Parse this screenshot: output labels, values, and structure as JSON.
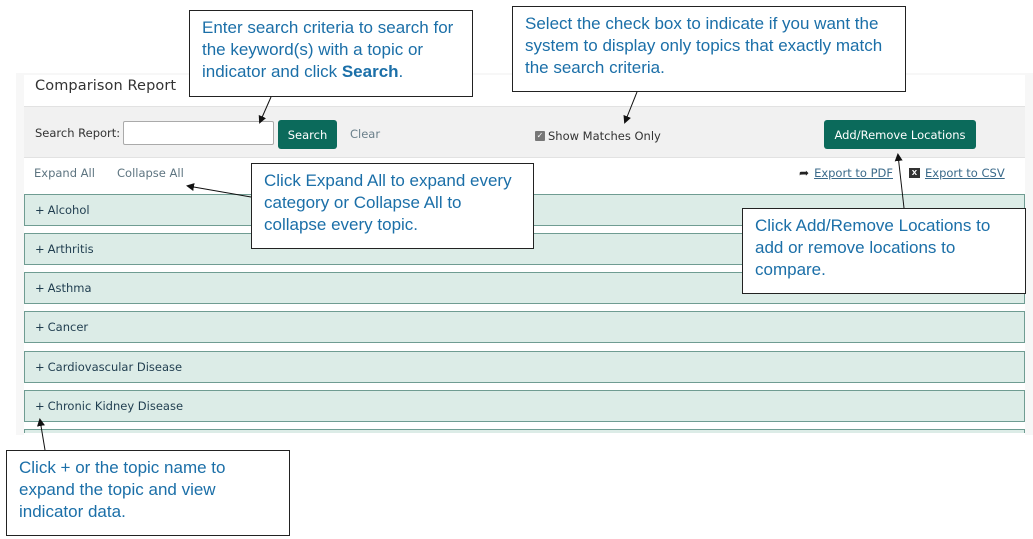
{
  "page": {
    "title": "Comparison Report"
  },
  "search": {
    "label": "Search Report:",
    "value": "",
    "placeholder": "",
    "search_button": "Search",
    "clear_link": "Clear",
    "show_matches_only": {
      "label": "Show Matches Only",
      "checked": true
    },
    "add_remove_button": "Add/Remove Locations"
  },
  "toolbar": {
    "expand_all": "Expand All",
    "collapse_all": "Collapse All",
    "export_pdf": "Export to PDF",
    "export_csv": "Export to CSV",
    "export_pdf_icon": "share-arrow-icon",
    "export_csv_icon": "excel-icon"
  },
  "topics": [
    {
      "expander": "+",
      "label": "Alcohol"
    },
    {
      "expander": "+",
      "label": "Arthritis"
    },
    {
      "expander": "+",
      "label": "Asthma"
    },
    {
      "expander": "+",
      "label": "Cancer"
    },
    {
      "expander": "+",
      "label": "Cardiovascular Disease"
    },
    {
      "expander": "+",
      "label": "Chronic Kidney Disease"
    }
  ],
  "callouts": {
    "search": {
      "text": "Enter search criteria to search for the keyword(s) with a topic or indicator and click ",
      "bold": "Search",
      "end": "."
    },
    "matches": {
      "text": "Select the check box to indicate if you want the system to display only topics that exactly match the search criteria."
    },
    "expand": {
      "text": "Click Expand All to expand every category or Collapse All to collapse every topic."
    },
    "locations": {
      "text": "Click Add/Remove Locations to add or remove locations to compare."
    },
    "topic": {
      "text": "Click + or the topic name to expand the topic and view indicator data."
    }
  },
  "colors": {
    "accent_green": "#0b6a5b",
    "topic_bg": "#dcece7",
    "topic_border": "#6f9c92",
    "callout_text": "#1b6fa8"
  }
}
